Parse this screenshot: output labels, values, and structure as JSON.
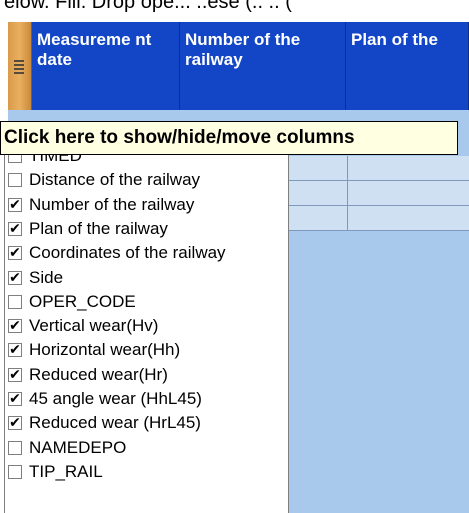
{
  "top_text": "elow. Fill. Drop ope... ..ese (.. .. (",
  "header": {
    "columns": [
      {
        "label": "Measureme nt date"
      },
      {
        "label": "Number of the railway"
      },
      {
        "label": "Plan of the"
      }
    ]
  },
  "tooltip": "Click here to show/hide/move columns",
  "column_chooser": {
    "items": [
      {
        "label": "TIMED",
        "checked": false
      },
      {
        "label": "Distance of the railway",
        "checked": false
      },
      {
        "label": "Number of the railway",
        "checked": true
      },
      {
        "label": "Plan of the railway",
        "checked": true
      },
      {
        "label": "Coordinates of the railway",
        "checked": true
      },
      {
        "label": "Side",
        "checked": true
      },
      {
        "label": "OPER_CODE",
        "checked": false
      },
      {
        "label": "Vertical wear(Hv)",
        "checked": true
      },
      {
        "label": "Horizontal wear(Hh)",
        "checked": true
      },
      {
        "label": "Reduced wear(Hr)",
        "checked": true
      },
      {
        "label": "45 angle wear (HhL45)",
        "checked": true
      },
      {
        "label": "Reduced wear (HrL45)",
        "checked": true
      },
      {
        "label": "NAMEDEPO",
        "checked": false
      },
      {
        "label": "TIP_RAIL",
        "checked": false
      }
    ]
  }
}
